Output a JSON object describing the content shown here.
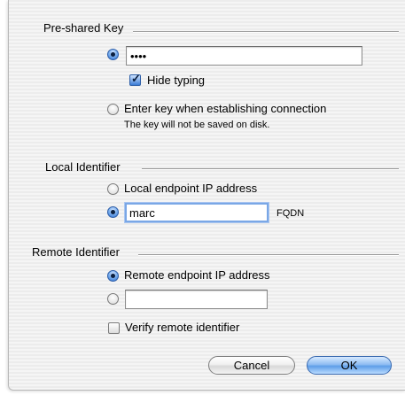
{
  "preshared": {
    "title": "Pre-shared Key",
    "key_value": "••••",
    "hide_typing_label": "Hide typing",
    "enter_key_label": "Enter key when establishing connection",
    "note": "The key will not be saved on disk."
  },
  "local": {
    "title": "Local Identifier",
    "endpoint_label": "Local endpoint IP address",
    "identifier_value": "marc",
    "identifier_type": "FQDN"
  },
  "remote": {
    "title": "Remote Identifier",
    "endpoint_label": "Remote endpoint IP address",
    "identifier_value": "",
    "verify_label": "Verify remote identifier"
  },
  "buttons": {
    "cancel": "Cancel",
    "ok": "OK"
  },
  "colors": {
    "selected_radio": "#3a7bd5",
    "default_button": "#6fa8ec"
  }
}
